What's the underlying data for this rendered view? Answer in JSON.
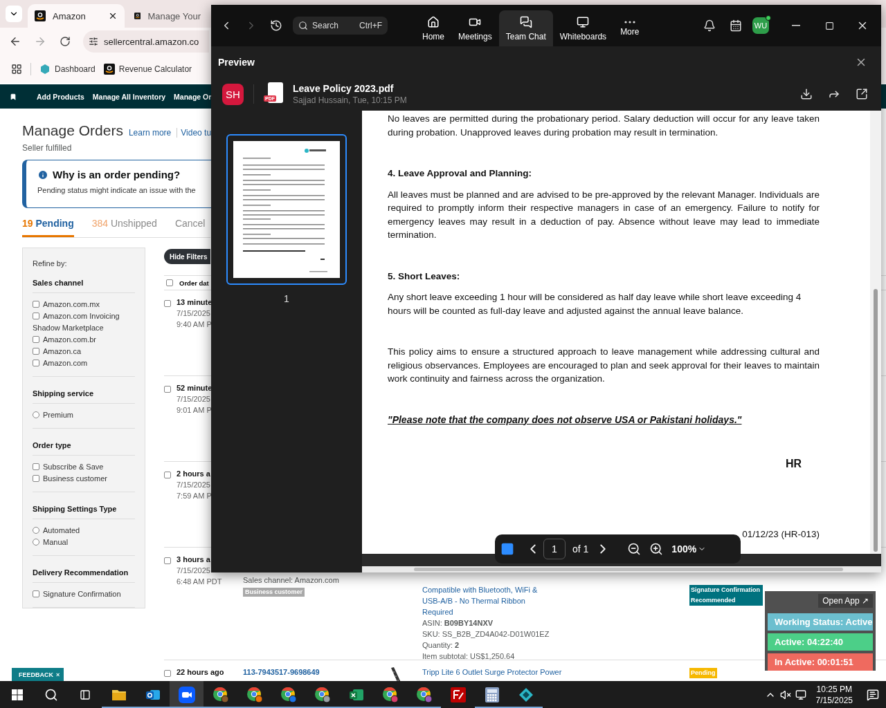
{
  "browser": {
    "tabs": [
      {
        "title": "Amazon",
        "selected": true
      },
      {
        "title": "Manage Your",
        "selected": false
      }
    ],
    "url": "sellercentral.amazon.co",
    "bookmarks": [
      {
        "kind": "dashboard",
        "label": "Dashboard"
      },
      {
        "kind": "amazon",
        "label": "Revenue Calculator"
      }
    ]
  },
  "seller_nav": [
    "Add Products",
    "Manage All Inventory",
    "Manage Or"
  ],
  "page": {
    "title": "Manage Orders",
    "links": [
      "Learn more",
      "Video tu"
    ],
    "subtitle": "Seller fulfilled",
    "alert": {
      "title": "Why is an order pending?",
      "text": "Pending status might indicate an issue with the"
    },
    "order_tabs": [
      {
        "count": "19",
        "label": "Pending",
        "selected": true
      },
      {
        "count": "384",
        "label": "Unshipped",
        "selected": false
      },
      {
        "label": "Cancel",
        "selected": false
      }
    ]
  },
  "filters": {
    "title": "Refine by:",
    "groups": [
      {
        "heading": "Sales channel",
        "options": [
          {
            "kind": "checkbox",
            "label": "Amazon.com.mx",
            "checked": false
          },
          {
            "kind": "checkbox",
            "label": "Amazon.com Invoicing Shadow Marketplace",
            "checked": false
          },
          {
            "kind": "checkbox",
            "label": "Amazon.com.br",
            "checked": false
          },
          {
            "kind": "checkbox",
            "label": "Amazon.ca",
            "checked": false
          },
          {
            "kind": "checkbox",
            "label": "Amazon.com",
            "checked": false
          }
        ]
      },
      {
        "heading": "Shipping service",
        "options": [
          {
            "kind": "radio",
            "label": "Premium",
            "checked": false
          }
        ]
      },
      {
        "heading": "Order type",
        "options": [
          {
            "kind": "checkbox",
            "label": "Subscribe & Save",
            "checked": false
          },
          {
            "kind": "checkbox",
            "label": "Business customer",
            "checked": false
          }
        ]
      },
      {
        "heading": "Shipping Settings Type",
        "options": [
          {
            "kind": "radio",
            "label": "Automated",
            "checked": false
          },
          {
            "kind": "radio",
            "label": "Manual",
            "checked": false
          }
        ]
      },
      {
        "heading": "Delivery Recommendation",
        "options": [
          {
            "kind": "checkbox",
            "label": "Signature Confirmation",
            "checked": false
          }
        ]
      }
    ]
  },
  "orders": {
    "hide_filters": "Hide Filters",
    "header": "Order dat",
    "header_checked": false,
    "rows": [
      {
        "checked": false,
        "age": "13 minute",
        "date": "7/15/2025",
        "time": "9:40 AM P"
      },
      {
        "checked": false,
        "age": "52 minute",
        "date": "7/15/2025",
        "time": "9:01 AM P"
      },
      {
        "checked": false,
        "age": "2 hours a",
        "date": "7/15/2025",
        "time": "7:59 AM P"
      },
      {
        "checked": false,
        "age": "3 hours a",
        "date": "7/15/2025",
        "time": "6:48 AM PDT",
        "sales_channel": "Sales channel: Amazon.com",
        "tags": [
          "Business customer"
        ],
        "product": "Compatible with Bluetooth, WiFi & USB-A/B - No Thermal Ribbon Required",
        "details": [
          "ASIN: **B09BY14NXV**",
          "SKU: SS_B2B_ZD4A042-D01W01EZ",
          "Quantity: **2**",
          "Item subtotal: US$1,250.64"
        ],
        "status": {
          "kind": "info",
          "text": "Signature Confirmation Recommended"
        }
      },
      {
        "checked": false,
        "age": "22 hours ago",
        "order_id": "113-7943517-9698649",
        "image": true,
        "product": "Tripp Lite 6 Outlet Surge Protector Power",
        "status": {
          "kind": "pending",
          "text": "Pending"
        }
      }
    ]
  },
  "zoom": {
    "search": {
      "placeholder": "Search",
      "shortcut": "Ctrl+F"
    },
    "tabs": [
      {
        "kind": "home",
        "label": "Home",
        "selected": false
      },
      {
        "kind": "meetings",
        "label": "Meetings",
        "selected": false
      },
      {
        "kind": "chat",
        "label": "Team Chat",
        "selected": true
      },
      {
        "kind": "whiteboards",
        "label": "Whiteboards",
        "selected": false
      },
      {
        "kind": "more",
        "label": "More",
        "selected": false
      }
    ],
    "user": {
      "initials": "WU",
      "online": true
    },
    "preview": {
      "title": "Preview",
      "sender_initials": "SH",
      "file_type": "PDF",
      "file_name": "Leave Policy 2023.pdf",
      "meta": "Sajjad Hussain, Tue, 10:15 PM"
    },
    "thumbnails": [
      {
        "label": "1",
        "selected": true
      }
    ],
    "document": {
      "blocks": [
        {
          "kind": "paragraph",
          "justified": true,
          "text": "No leaves are permitted during the probationary period. Salary deduction will occur for any leave taken during probation. Unapproved leaves during probation may result in termination."
        },
        {
          "kind": "heading",
          "text": "4. Leave Approval and Planning:"
        },
        {
          "kind": "paragraph",
          "justified": true,
          "text": "All leaves must be planned and are advised to be pre-approved by the relevant Manager. Individuals are required to promptly inform their respective managers in case of an emergency. Failure to notify for emergency leaves may result in a deduction of pay. Absence without leave may lead to immediate termination."
        },
        {
          "kind": "heading",
          "text": "5. Short Leaves:"
        },
        {
          "kind": "paragraph",
          "justified": false,
          "text": "Any short leave exceeding 1 hour will be considered as half day leave while short leave exceeding 4 hours will be counted as full-day leave and adjusted against the annual leave balance."
        },
        {
          "kind": "paragraph",
          "justified": true,
          "text": "This policy aims to ensure a structured approach to leave management while addressing cultural and religious observances. Employees are encouraged to plan and seek approval for their leaves to maintain work continuity and fairness across the organization."
        },
        {
          "kind": "note",
          "text": "\"Please note that the company does not observe USA or Pakistani holidays.\""
        },
        {
          "kind": "signature",
          "text": "HR"
        },
        {
          "kind": "reference",
          "text": "01/12/23 (HR-013)"
        }
      ]
    },
    "pager": {
      "thumbnails_visible": true,
      "page": "1",
      "total": "of 1",
      "zoom": "100%"
    }
  },
  "widget": {
    "open_app": "Open App ↗",
    "rows": [
      {
        "text": "Working Status: Active",
        "color": "#6cbfcf"
      },
      {
        "text": "Active: 04:22:40",
        "color": "#4ccf88"
      },
      {
        "text": "In Active: 00:01:51",
        "color": "#ef6a5f"
      }
    ]
  },
  "feedback": {
    "label": "FEEDBACK",
    "close": "×"
  },
  "taskbar": {
    "apps": [
      {
        "kind": "explorer",
        "running": true,
        "selected": false
      },
      {
        "kind": "outlook",
        "running": true,
        "selected": false
      },
      {
        "kind": "zoom",
        "running": true,
        "selected": true
      },
      {
        "kind": "chrome",
        "running": true,
        "selected": false,
        "color": "#8b5a2b"
      },
      {
        "kind": "chrome",
        "running": true,
        "selected": false,
        "color": "#e8710a"
      },
      {
        "kind": "chrome",
        "running": true,
        "selected": false,
        "color": "#1a73e8"
      },
      {
        "kind": "chrome",
        "running": true,
        "selected": false,
        "color": "#9aa0a6"
      },
      {
        "kind": "excel",
        "running": true,
        "selected": false
      },
      {
        "kind": "chrome",
        "running": true,
        "selected": false,
        "color": "#d93d6a"
      },
      {
        "kind": "chrome",
        "running": true,
        "selected": false,
        "color": "#9b59b6"
      },
      {
        "kind": "filezilla",
        "running": false,
        "selected": false
      },
      {
        "kind": "calculator",
        "running": true,
        "selected": false
      },
      {
        "kind": "diamond",
        "running": true,
        "selected": false
      }
    ],
    "time": "10:25 PM",
    "date": "7/15/2025"
  }
}
